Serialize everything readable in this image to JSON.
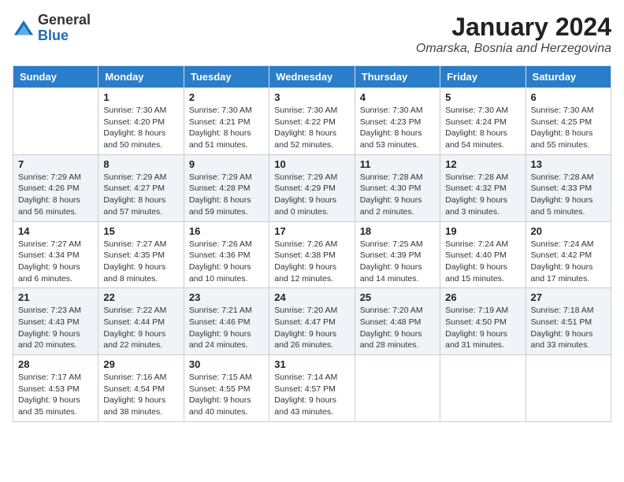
{
  "logo": {
    "general": "General",
    "blue": "Blue"
  },
  "header": {
    "title": "January 2024",
    "subtitle": "Omarska, Bosnia and Herzegovina"
  },
  "weekdays": [
    "Sunday",
    "Monday",
    "Tuesday",
    "Wednesday",
    "Thursday",
    "Friday",
    "Saturday"
  ],
  "weeks": [
    [
      {
        "day": "",
        "sunrise": "",
        "sunset": "",
        "daylight": ""
      },
      {
        "day": "1",
        "sunrise": "Sunrise: 7:30 AM",
        "sunset": "Sunset: 4:20 PM",
        "daylight": "Daylight: 8 hours and 50 minutes."
      },
      {
        "day": "2",
        "sunrise": "Sunrise: 7:30 AM",
        "sunset": "Sunset: 4:21 PM",
        "daylight": "Daylight: 8 hours and 51 minutes."
      },
      {
        "day": "3",
        "sunrise": "Sunrise: 7:30 AM",
        "sunset": "Sunset: 4:22 PM",
        "daylight": "Daylight: 8 hours and 52 minutes."
      },
      {
        "day": "4",
        "sunrise": "Sunrise: 7:30 AM",
        "sunset": "Sunset: 4:23 PM",
        "daylight": "Daylight: 8 hours and 53 minutes."
      },
      {
        "day": "5",
        "sunrise": "Sunrise: 7:30 AM",
        "sunset": "Sunset: 4:24 PM",
        "daylight": "Daylight: 8 hours and 54 minutes."
      },
      {
        "day": "6",
        "sunrise": "Sunrise: 7:30 AM",
        "sunset": "Sunset: 4:25 PM",
        "daylight": "Daylight: 8 hours and 55 minutes."
      }
    ],
    [
      {
        "day": "7",
        "sunrise": "Sunrise: 7:29 AM",
        "sunset": "Sunset: 4:26 PM",
        "daylight": "Daylight: 8 hours and 56 minutes."
      },
      {
        "day": "8",
        "sunrise": "Sunrise: 7:29 AM",
        "sunset": "Sunset: 4:27 PM",
        "daylight": "Daylight: 8 hours and 57 minutes."
      },
      {
        "day": "9",
        "sunrise": "Sunrise: 7:29 AM",
        "sunset": "Sunset: 4:28 PM",
        "daylight": "Daylight: 8 hours and 59 minutes."
      },
      {
        "day": "10",
        "sunrise": "Sunrise: 7:29 AM",
        "sunset": "Sunset: 4:29 PM",
        "daylight": "Daylight: 9 hours and 0 minutes."
      },
      {
        "day": "11",
        "sunrise": "Sunrise: 7:28 AM",
        "sunset": "Sunset: 4:30 PM",
        "daylight": "Daylight: 9 hours and 2 minutes."
      },
      {
        "day": "12",
        "sunrise": "Sunrise: 7:28 AM",
        "sunset": "Sunset: 4:32 PM",
        "daylight": "Daylight: 9 hours and 3 minutes."
      },
      {
        "day": "13",
        "sunrise": "Sunrise: 7:28 AM",
        "sunset": "Sunset: 4:33 PM",
        "daylight": "Daylight: 9 hours and 5 minutes."
      }
    ],
    [
      {
        "day": "14",
        "sunrise": "Sunrise: 7:27 AM",
        "sunset": "Sunset: 4:34 PM",
        "daylight": "Daylight: 9 hours and 6 minutes."
      },
      {
        "day": "15",
        "sunrise": "Sunrise: 7:27 AM",
        "sunset": "Sunset: 4:35 PM",
        "daylight": "Daylight: 9 hours and 8 minutes."
      },
      {
        "day": "16",
        "sunrise": "Sunrise: 7:26 AM",
        "sunset": "Sunset: 4:36 PM",
        "daylight": "Daylight: 9 hours and 10 minutes."
      },
      {
        "day": "17",
        "sunrise": "Sunrise: 7:26 AM",
        "sunset": "Sunset: 4:38 PM",
        "daylight": "Daylight: 9 hours and 12 minutes."
      },
      {
        "day": "18",
        "sunrise": "Sunrise: 7:25 AM",
        "sunset": "Sunset: 4:39 PM",
        "daylight": "Daylight: 9 hours and 14 minutes."
      },
      {
        "day": "19",
        "sunrise": "Sunrise: 7:24 AM",
        "sunset": "Sunset: 4:40 PM",
        "daylight": "Daylight: 9 hours and 15 minutes."
      },
      {
        "day": "20",
        "sunrise": "Sunrise: 7:24 AM",
        "sunset": "Sunset: 4:42 PM",
        "daylight": "Daylight: 9 hours and 17 minutes."
      }
    ],
    [
      {
        "day": "21",
        "sunrise": "Sunrise: 7:23 AM",
        "sunset": "Sunset: 4:43 PM",
        "daylight": "Daylight: 9 hours and 20 minutes."
      },
      {
        "day": "22",
        "sunrise": "Sunrise: 7:22 AM",
        "sunset": "Sunset: 4:44 PM",
        "daylight": "Daylight: 9 hours and 22 minutes."
      },
      {
        "day": "23",
        "sunrise": "Sunrise: 7:21 AM",
        "sunset": "Sunset: 4:46 PM",
        "daylight": "Daylight: 9 hours and 24 minutes."
      },
      {
        "day": "24",
        "sunrise": "Sunrise: 7:20 AM",
        "sunset": "Sunset: 4:47 PM",
        "daylight": "Daylight: 9 hours and 26 minutes."
      },
      {
        "day": "25",
        "sunrise": "Sunrise: 7:20 AM",
        "sunset": "Sunset: 4:48 PM",
        "daylight": "Daylight: 9 hours and 28 minutes."
      },
      {
        "day": "26",
        "sunrise": "Sunrise: 7:19 AM",
        "sunset": "Sunset: 4:50 PM",
        "daylight": "Daylight: 9 hours and 31 minutes."
      },
      {
        "day": "27",
        "sunrise": "Sunrise: 7:18 AM",
        "sunset": "Sunset: 4:51 PM",
        "daylight": "Daylight: 9 hours and 33 minutes."
      }
    ],
    [
      {
        "day": "28",
        "sunrise": "Sunrise: 7:17 AM",
        "sunset": "Sunset: 4:53 PM",
        "daylight": "Daylight: 9 hours and 35 minutes."
      },
      {
        "day": "29",
        "sunrise": "Sunrise: 7:16 AM",
        "sunset": "Sunset: 4:54 PM",
        "daylight": "Daylight: 9 hours and 38 minutes."
      },
      {
        "day": "30",
        "sunrise": "Sunrise: 7:15 AM",
        "sunset": "Sunset: 4:55 PM",
        "daylight": "Daylight: 9 hours and 40 minutes."
      },
      {
        "day": "31",
        "sunrise": "Sunrise: 7:14 AM",
        "sunset": "Sunset: 4:57 PM",
        "daylight": "Daylight: 9 hours and 43 minutes."
      },
      {
        "day": "",
        "sunrise": "",
        "sunset": "",
        "daylight": ""
      },
      {
        "day": "",
        "sunrise": "",
        "sunset": "",
        "daylight": ""
      },
      {
        "day": "",
        "sunrise": "",
        "sunset": "",
        "daylight": ""
      }
    ]
  ],
  "colors": {
    "header_bg": "#2a7dc9",
    "row_shaded": "#f0f4f8",
    "row_white": "#ffffff"
  }
}
